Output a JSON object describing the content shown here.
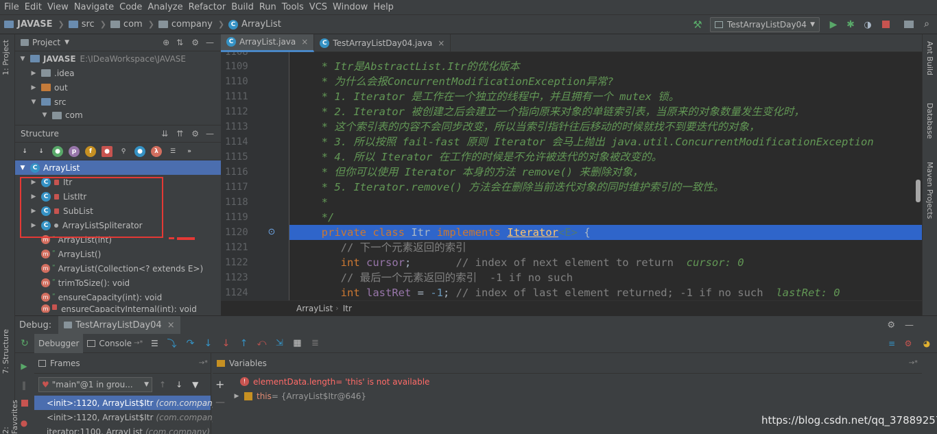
{
  "menu": [
    "File",
    "Edit",
    "View",
    "Navigate",
    "Code",
    "Analyze",
    "Refactor",
    "Build",
    "Run",
    "Tools",
    "VCS",
    "Window",
    "Help"
  ],
  "navbar": {
    "crumbs": [
      "JAVASE",
      "src",
      "com",
      "company",
      "ArrayList"
    ],
    "run_config": "TestArrayListDay04"
  },
  "left_strip": {
    "project": "1: Project",
    "structure": "7: Structure",
    "favorites": "2: Favorites"
  },
  "right_strip": {
    "ant": "Ant Build",
    "database": "Database",
    "maven": "Maven Projects"
  },
  "project": {
    "title": "Project",
    "root_name": "JAVASE",
    "root_path": "E:\\IDeaWorkspace\\JAVASE",
    "items": [
      ".idea",
      "out",
      "src",
      "com"
    ]
  },
  "structure": {
    "title": "Structure",
    "root": "ArrayList",
    "inner_classes": [
      "Itr",
      "ListItr",
      "SubList",
      "ArrayListSpliterator"
    ],
    "members": [
      "ArrayList(int)",
      "ArrayList()",
      "ArrayList(Collection<? extends E>)",
      "trimToSize(): void",
      "ensureCapacity(int): void",
      "ensureCapacityInternal(int): void"
    ]
  },
  "editor": {
    "tabs": [
      "ArrayList.java",
      "TestArrayListDay04.java"
    ],
    "top_line": "1108",
    "lines": [
      {
        "n": "1109",
        "t": "     * Itr是AbstractList.Itr的优化版本"
      },
      {
        "n": "1110",
        "t": "     * 为什么会报ConcurrentModificationException异常?"
      },
      {
        "n": "1111",
        "t": "     * 1. Iterator 是工作在一个独立的线程中，并且拥有一个 mutex 锁。"
      },
      {
        "n": "1112",
        "t": "     * 2. Iterator 被创建之后会建立一个指向原来对象的单链索引表，当原来的对象数量发生变化时，"
      },
      {
        "n": "1113",
        "t": "     * 这个索引表的内容不会同步改变，所以当索引指针往后移动的时候就找不到要迭代的对象，"
      },
      {
        "n": "1114",
        "t": "     * 3. 所以按照 fail-fast 原则 Iterator 会马上抛出 java.util.ConcurrentModificationException"
      },
      {
        "n": "1115",
        "t": "     * 4. 所以 Iterator 在工作的时候是不允许被迭代的对象被改变的。"
      },
      {
        "n": "1116",
        "t": "     * 但你可以使用 Iterator 本身的方法 remove() 来删除对象，"
      },
      {
        "n": "1117",
        "t": "     * 5. Iterator.remove() 方法会在删除当前迭代对象的同时维护索引的一致性。"
      },
      {
        "n": "1118",
        "t": "     *"
      },
      {
        "n": "1119",
        "t": "     */"
      }
    ],
    "decl": {
      "n": "1120",
      "kw1": "private class",
      "name": "Itr",
      "kw2": "implements",
      "iface": "Iterator",
      "gen": "<E>",
      "brace": " {"
    },
    "l1121": {
      "n": "1121",
      "t": "        // 下一个元素返回的索引"
    },
    "l1122": {
      "n": "1122",
      "kw": "int",
      "var": "cursor",
      "rest": ";       ",
      "cmt": "// index of next element to return",
      "hint": "cursor: 0"
    },
    "l1123": {
      "n": "1123",
      "t": "        // 最后一个元素返回的索引  -1 if no such"
    },
    "l1124": {
      "n": "1124",
      "kw": "int",
      "var": "lastRet",
      "eq": " = ",
      "num": "-1",
      "rest": "; ",
      "cmt": "// index of last element returned; -1 if no such",
      "hint": "lastRet: 0"
    },
    "breadcrumb": [
      "ArrayList",
      "Itr"
    ]
  },
  "debug": {
    "label": "Debug:",
    "session": "TestArrayListDay04",
    "tabs": [
      "Debugger",
      "Console"
    ],
    "frames_title": "Frames",
    "vars_title": "Variables",
    "thread": "\"main\"@1 in grou...",
    "frames": [
      {
        "m": "<init>:1120, ArrayList$Itr",
        "p": "(com.company)"
      },
      {
        "m": "<init>:1120, ArrayList$Itr",
        "p": "(com.company)"
      },
      {
        "m": "iterator:1100, ArrayList",
        "p": "(com.company)"
      }
    ],
    "var_error": {
      "name": "elementData.length",
      "val": " = 'this' is not available"
    },
    "var_this": {
      "name": "this",
      "val": " = {ArrayList$Itr@646}"
    }
  },
  "watermark": "https://blog.csdn.net/qq_37889257",
  "colors": {
    "accent": "#4a88c7",
    "selection": "#2f65ca",
    "comment": "#629755",
    "keyword": "#cc7832",
    "highlight_box": "#e53935"
  }
}
